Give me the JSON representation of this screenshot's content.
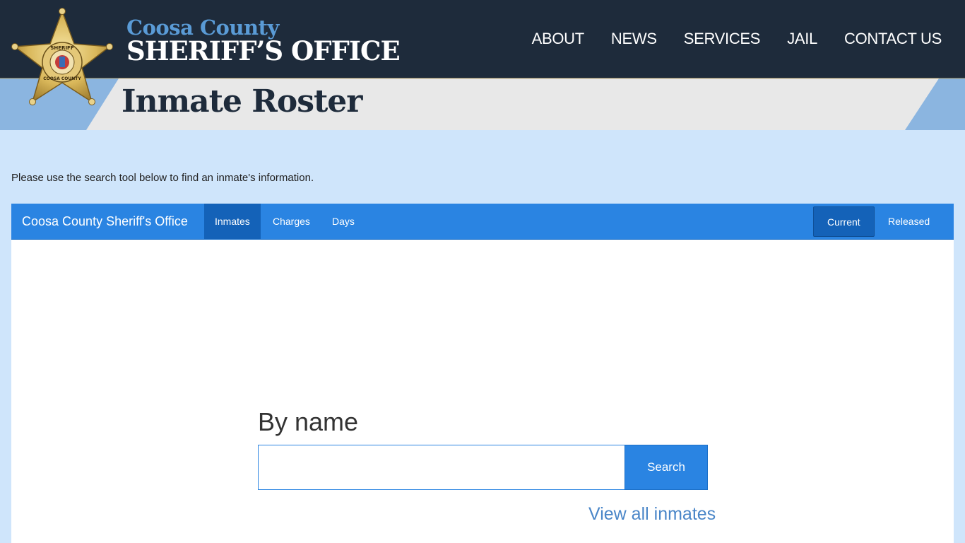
{
  "header": {
    "brand_line1": "Coosa County",
    "brand_line2": "SHERIFF’S OFFICE",
    "badge_text_top": "SHERIFF",
    "badge_text_bottom": "COOSA COUNTY",
    "nav": [
      "ABOUT",
      "NEWS",
      "SERVICES",
      "JAIL",
      "CONTACT US"
    ]
  },
  "page": {
    "title": "Inmate Roster",
    "intro": "Please use the search tool below to find an inmate's information."
  },
  "app_nav": {
    "brand": "Coosa County Sheriff's Office",
    "tabs": [
      "Inmates",
      "Charges",
      "Days"
    ],
    "active_tab": "Inmates",
    "status_toggle": [
      "Current",
      "Released"
    ],
    "active_status": "Current"
  },
  "search": {
    "heading": "By name",
    "input_value": "",
    "button_label": "Search",
    "view_all_label": "View all inmates"
  },
  "colors": {
    "header_bg": "#1e2b3b",
    "accent_blue": "#2a84e2",
    "page_bg": "#cfe5fb",
    "brand_light_blue": "#5a9bd6"
  }
}
